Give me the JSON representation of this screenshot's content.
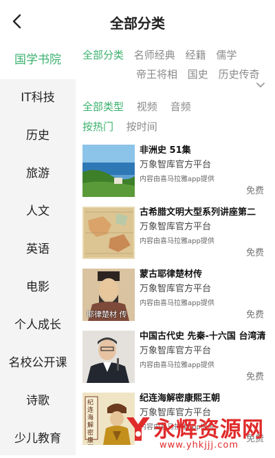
{
  "header": {
    "title": "全部分类",
    "back_icon": "chevron-left-icon"
  },
  "sidebar": {
    "items": [
      {
        "label": "国学书院",
        "active": true
      },
      {
        "label": "IT科技"
      },
      {
        "label": "历史"
      },
      {
        "label": "旅游"
      },
      {
        "label": "人文"
      },
      {
        "label": "英语"
      },
      {
        "label": "电影"
      },
      {
        "label": "个人成长"
      },
      {
        "label": "名校公开课"
      },
      {
        "label": "诗歌"
      },
      {
        "label": "少儿教育"
      }
    ]
  },
  "categories": {
    "row1": [
      "全部分类",
      "名师经典",
      "经籍",
      "儒学"
    ],
    "row2": [
      "帝王将相",
      "国史",
      "历史传奇"
    ],
    "active": "全部分类",
    "expand_icon": "chevron-down-icon"
  },
  "types": {
    "options": [
      "全部类型",
      "视频",
      "音频"
    ],
    "active": "全部类型"
  },
  "sort": {
    "options": [
      "按热门",
      "按时间"
    ],
    "active": "按热门"
  },
  "items": [
    {
      "title": "非洲史 51集",
      "publisher": "万象智库官方平台",
      "source": "内容由喜马拉雅app提供",
      "price": "免费"
    },
    {
      "title": "古希腊文明大型系列讲座第二",
      "publisher": "万象智库官方平台",
      "source": "内容由喜马拉雅app提供",
      "price": "免费"
    },
    {
      "title": "蒙古耶律楚材传",
      "publisher": "万象智库官方平台",
      "source": "内容由喜马拉雅app提供",
      "price": "免费",
      "thumb_caption": "耶律楚材 传"
    },
    {
      "title": "中国古代史 先秦-十六国 台湾清",
      "publisher": "万象智库官方平台",
      "source": "内容由喜马拉雅app提供",
      "price": "免费"
    },
    {
      "title": "纪连海解密康熙王朝",
      "publisher": "万象智库官方平台",
      "source": "内容由喜马拉雅app提供",
      "price": "免费",
      "thumb_caption": "纪连海解密康熙王朝"
    }
  ],
  "watermark": {
    "text": "永辉资源网",
    "url": "www.yhkjjj.com"
  },
  "colors": {
    "accent": "#3bb16e",
    "muted": "#8a8a8a",
    "watermark": "#e02b2b"
  }
}
